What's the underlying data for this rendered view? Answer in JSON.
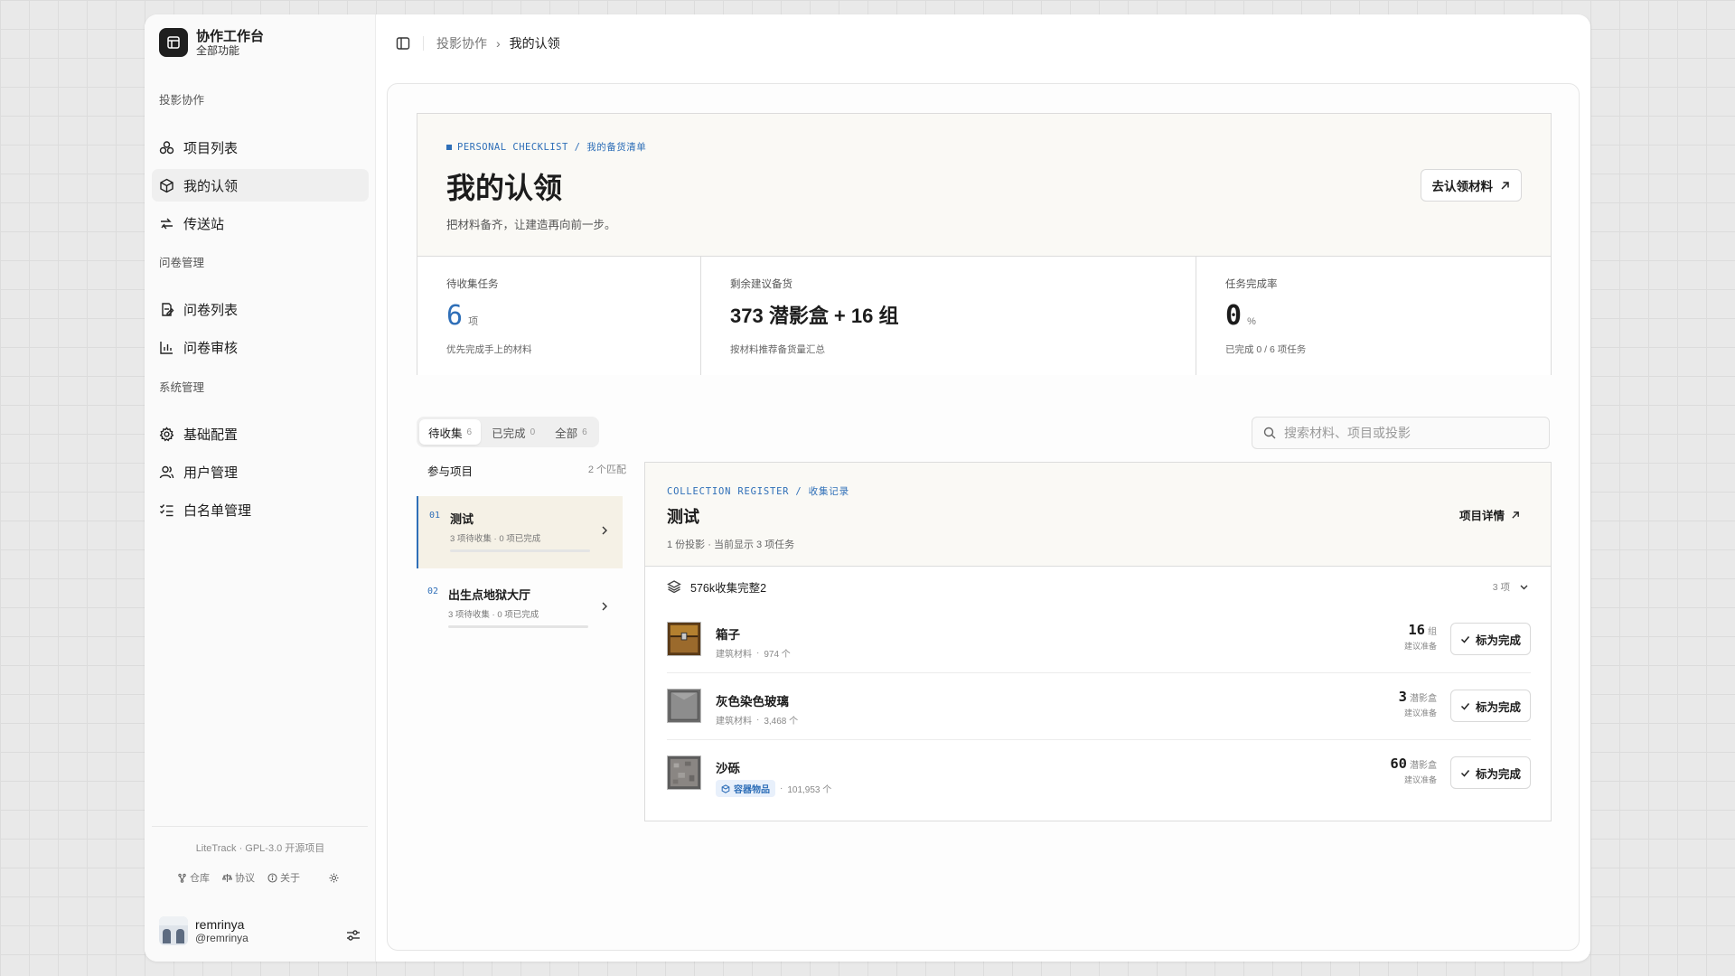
{
  "brand": {
    "title": "协作工作台",
    "subtitle": "全部功能"
  },
  "sidebar": {
    "groups": [
      {
        "label": "投影协作",
        "items": [
          {
            "label": "项目列表",
            "icon": "cluster-icon"
          },
          {
            "label": "我的认领",
            "icon": "package-icon",
            "active": true
          },
          {
            "label": "传送站",
            "icon": "transfer-icon"
          }
        ]
      },
      {
        "label": "问卷管理",
        "items": [
          {
            "label": "问卷列表",
            "icon": "form-icon"
          },
          {
            "label": "问卷审核",
            "icon": "chart-icon"
          }
        ]
      },
      {
        "label": "系统管理",
        "items": [
          {
            "label": "基础配置",
            "icon": "gear-icon"
          },
          {
            "label": "用户管理",
            "icon": "users-icon"
          },
          {
            "label": "白名单管理",
            "icon": "checklist-icon"
          }
        ]
      }
    ],
    "license": "LiteTrack · GPL-3.0 开源项目",
    "footer_links": [
      "仓库",
      "协议",
      "关于"
    ],
    "user": {
      "name": "remrinya",
      "handle": "@remrinya"
    }
  },
  "breadcrumb": {
    "parent": "投影协作",
    "current": "我的认领"
  },
  "hero": {
    "tag": "PERSONAL CHECKLIST / 我的备货清单",
    "title": "我的认领",
    "subtitle": "把材料备齐，让建造再向前一步。",
    "button": "去认领材料"
  },
  "stats": [
    {
      "label": "待收集任务",
      "value": "6",
      "unit": "项",
      "hint": "优先完成手上的材料"
    },
    {
      "label": "剩余建议备货",
      "value": "373 潜影盒 + 16 组",
      "hint": "按材料推荐备货量汇总"
    },
    {
      "label": "任务完成率",
      "value": "0",
      "unit": "%",
      "hint": "已完成 0 / 6 项任务"
    }
  ],
  "tabs": [
    {
      "label": "待收集",
      "count": "6",
      "active": true
    },
    {
      "label": "已完成",
      "count": "0"
    },
    {
      "label": "全部",
      "count": "6"
    }
  ],
  "search": {
    "placeholder": "搜索材料、项目或投影"
  },
  "projects": {
    "header": "参与项目",
    "match_count": "2 个匹配",
    "items": [
      {
        "num": "01",
        "name": "测试",
        "meta": "3 项待收集 · 0 项已完成",
        "progress": 0,
        "active": true
      },
      {
        "num": "02",
        "name": "出生点地狱大厅",
        "meta": "3 项待收集 · 0 项已完成",
        "progress": 0
      }
    ]
  },
  "detail": {
    "tag": "COLLECTION REGISTER / 收集记录",
    "title": "测试",
    "subtitle": "1 份投影 · 当前显示 3 项任务",
    "button": "项目详情",
    "group": {
      "name": "576k收集完整2",
      "count": "3 项"
    },
    "materials": [
      {
        "name": "箱子",
        "category": "建筑材料",
        "amount": "974 个",
        "qty": "16",
        "unit": "组",
        "hint": "建议准备",
        "icon": "chest-icon",
        "action": "标为完成"
      },
      {
        "name": "灰色染色玻璃",
        "category": "建筑材料",
        "amount": "3,468 个",
        "qty": "3",
        "unit": "潜影盒",
        "hint": "建议准备",
        "icon": "gray-glass-icon",
        "action": "标为完成"
      },
      {
        "name": "沙砾",
        "category": "容器物品",
        "amount": "101,953 个",
        "qty": "60",
        "unit": "潜影盒",
        "hint": "建议准备",
        "icon": "gravel-icon",
        "action": "标为完成",
        "chip": true
      }
    ]
  },
  "colors": {
    "accent": "#2f6fb8",
    "hero_bg": "#faf9f5",
    "active_project_bg": "#f5f1e6"
  }
}
